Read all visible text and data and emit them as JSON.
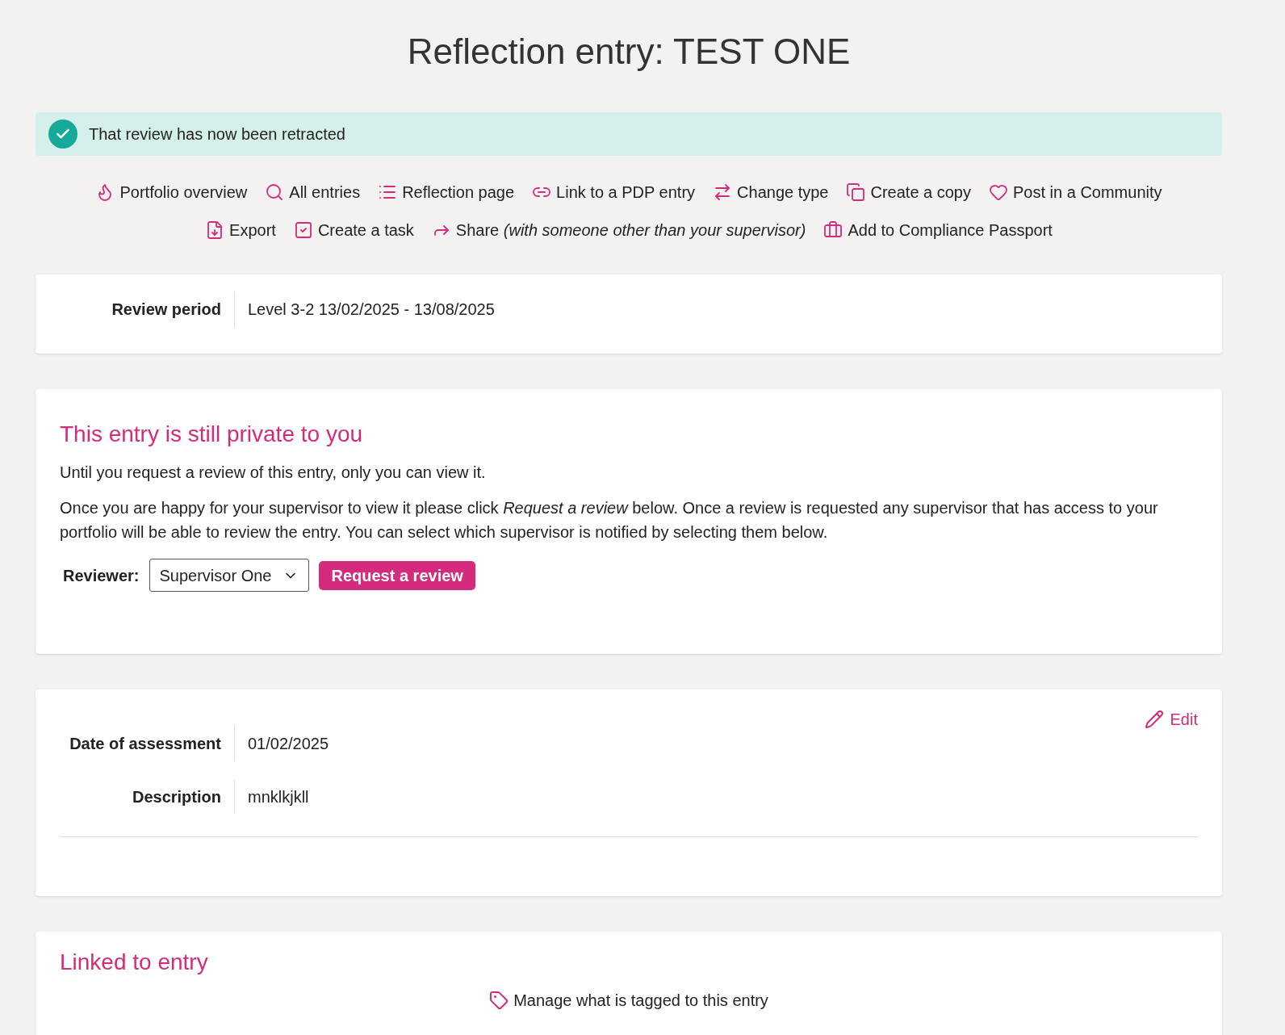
{
  "page_title": "Reflection entry: TEST ONE",
  "alert": {
    "message": "That review has now been retracted"
  },
  "actions": [
    {
      "label": "Portfolio overview"
    },
    {
      "label": "All entries"
    },
    {
      "label": "Reflection page"
    },
    {
      "label": "Link to a PDP entry"
    },
    {
      "label": "Change type"
    },
    {
      "label": "Create a copy"
    },
    {
      "label": "Post in a Community"
    },
    {
      "label": "Export"
    },
    {
      "label": "Create a task"
    },
    {
      "label": "Share *(with someone other than your supervisor)*"
    },
    {
      "label": "Add to Compliance Passport"
    }
  ],
  "review_period": {
    "label": "Review period",
    "value": "Level 3-2 13/02/2025 - 13/08/2025"
  },
  "privacy": {
    "heading": "This entry is still private to you",
    "paragraphs": [
      "Until you request a review of this entry, only you can view it.",
      "Once you are happy for your supervisor to view it please click *Request a review* below. Once a review is requested any supervisor that has access to your portfolio will be able to review the entry. You can select which supervisor is notified by selecting them below."
    ],
    "reviewer_label": "Reviewer:",
    "reviewer_value": "Supervisor One",
    "request_button": "Request a review"
  },
  "details": {
    "edit": "Edit",
    "fields": [
      {
        "label": "Date of assessment",
        "value": "01/02/2025"
      },
      {
        "label": "Description",
        "value": "mnklkjkll"
      }
    ]
  },
  "linked": {
    "heading": "Linked to entry",
    "manage": "Manage what is tagged to this entry"
  }
}
